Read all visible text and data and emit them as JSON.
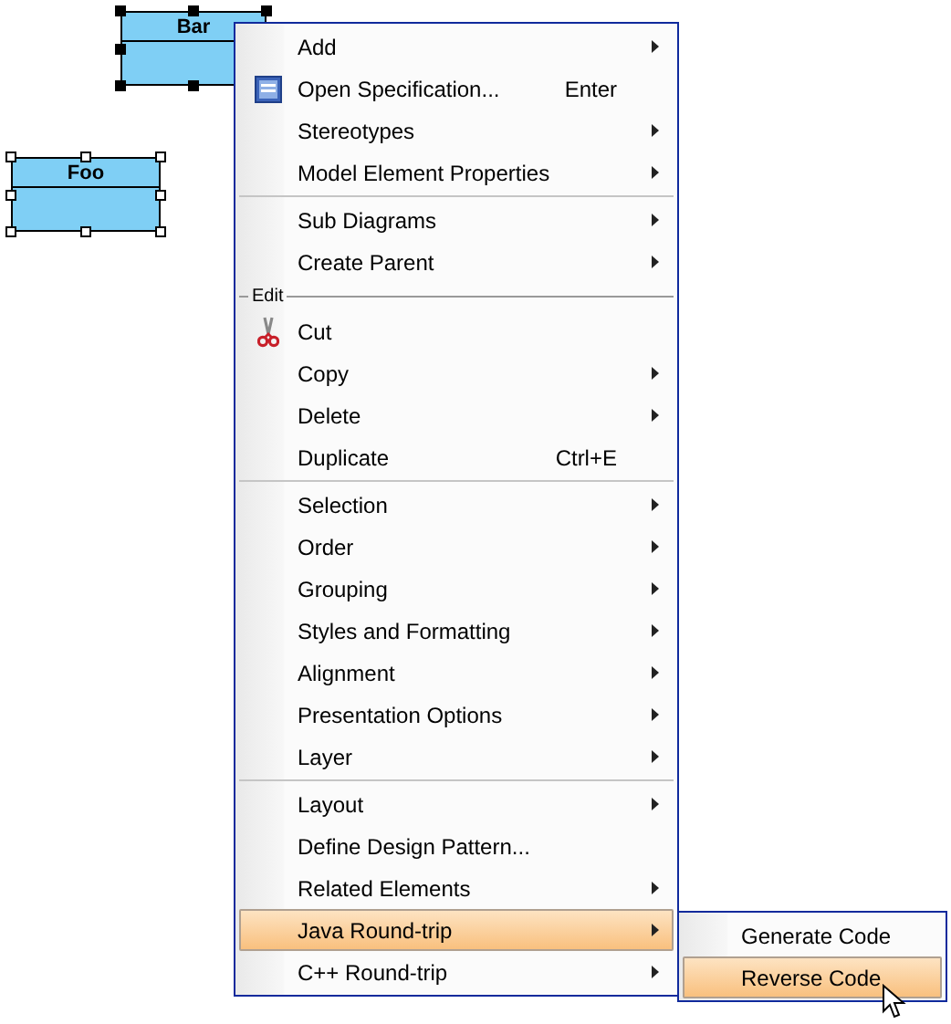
{
  "diagram": {
    "classes": [
      {
        "name": "Bar",
        "selected": true
      },
      {
        "name": "Foo",
        "selected": false
      }
    ]
  },
  "context_menu": {
    "items": [
      {
        "kind": "item",
        "label": "Add",
        "has_submenu": true,
        "selected": false
      },
      {
        "kind": "document_item",
        "label": "Open Specification...",
        "shortcut": "Enter",
        "has_submenu": false,
        "selected": false
      },
      {
        "kind": "item",
        "label": "Stereotypes",
        "has_submenu": true,
        "selected": false
      },
      {
        "kind": "item",
        "label": "Model Element Properties",
        "has_submenu": true,
        "selected": false
      },
      {
        "kind": "separator"
      },
      {
        "kind": "item",
        "label": "Sub Diagrams",
        "has_submenu": true,
        "selected": false
      },
      {
        "kind": "item",
        "label": "Create Parent",
        "has_submenu": true,
        "selected": false
      },
      {
        "kind": "header",
        "label": "Edit"
      },
      {
        "kind": "scissors_item",
        "label": "Cut",
        "has_submenu": false,
        "selected": false
      },
      {
        "kind": "item",
        "label": "Copy",
        "has_submenu": true,
        "selected": false
      },
      {
        "kind": "item",
        "label": "Delete",
        "has_submenu": true,
        "selected": false
      },
      {
        "kind": "item",
        "label": "Duplicate",
        "shortcut": "Ctrl+E",
        "has_submenu": false,
        "selected": false
      },
      {
        "kind": "separator"
      },
      {
        "kind": "item",
        "label": "Selection",
        "has_submenu": true,
        "selected": false
      },
      {
        "kind": "item",
        "label": "Order",
        "has_submenu": true,
        "selected": false
      },
      {
        "kind": "item",
        "label": "Grouping",
        "has_submenu": true,
        "selected": false
      },
      {
        "kind": "item",
        "label": "Styles and Formatting",
        "has_submenu": true,
        "selected": false
      },
      {
        "kind": "item",
        "label": "Alignment",
        "has_submenu": true,
        "selected": false
      },
      {
        "kind": "item",
        "label": "Presentation Options",
        "has_submenu": true,
        "selected": false
      },
      {
        "kind": "item",
        "label": "Layer",
        "has_submenu": true,
        "selected": false
      },
      {
        "kind": "separator"
      },
      {
        "kind": "item",
        "label": "Layout",
        "has_submenu": true,
        "selected": false
      },
      {
        "kind": "item",
        "label": "Define Design Pattern...",
        "has_submenu": false,
        "selected": false
      },
      {
        "kind": "item",
        "label": "Related Elements",
        "has_submenu": true,
        "selected": false
      },
      {
        "kind": "item",
        "label": "Java Round-trip",
        "has_submenu": true,
        "selected": true
      },
      {
        "kind": "item",
        "label": "C++ Round-trip",
        "has_submenu": true,
        "selected": false
      }
    ]
  },
  "submenu": {
    "items": [
      {
        "kind": "item",
        "label": "Generate Code",
        "has_submenu": false,
        "selected": false
      },
      {
        "kind": "item",
        "label": "Reverse Code",
        "has_submenu": false,
        "selected": true
      }
    ]
  }
}
